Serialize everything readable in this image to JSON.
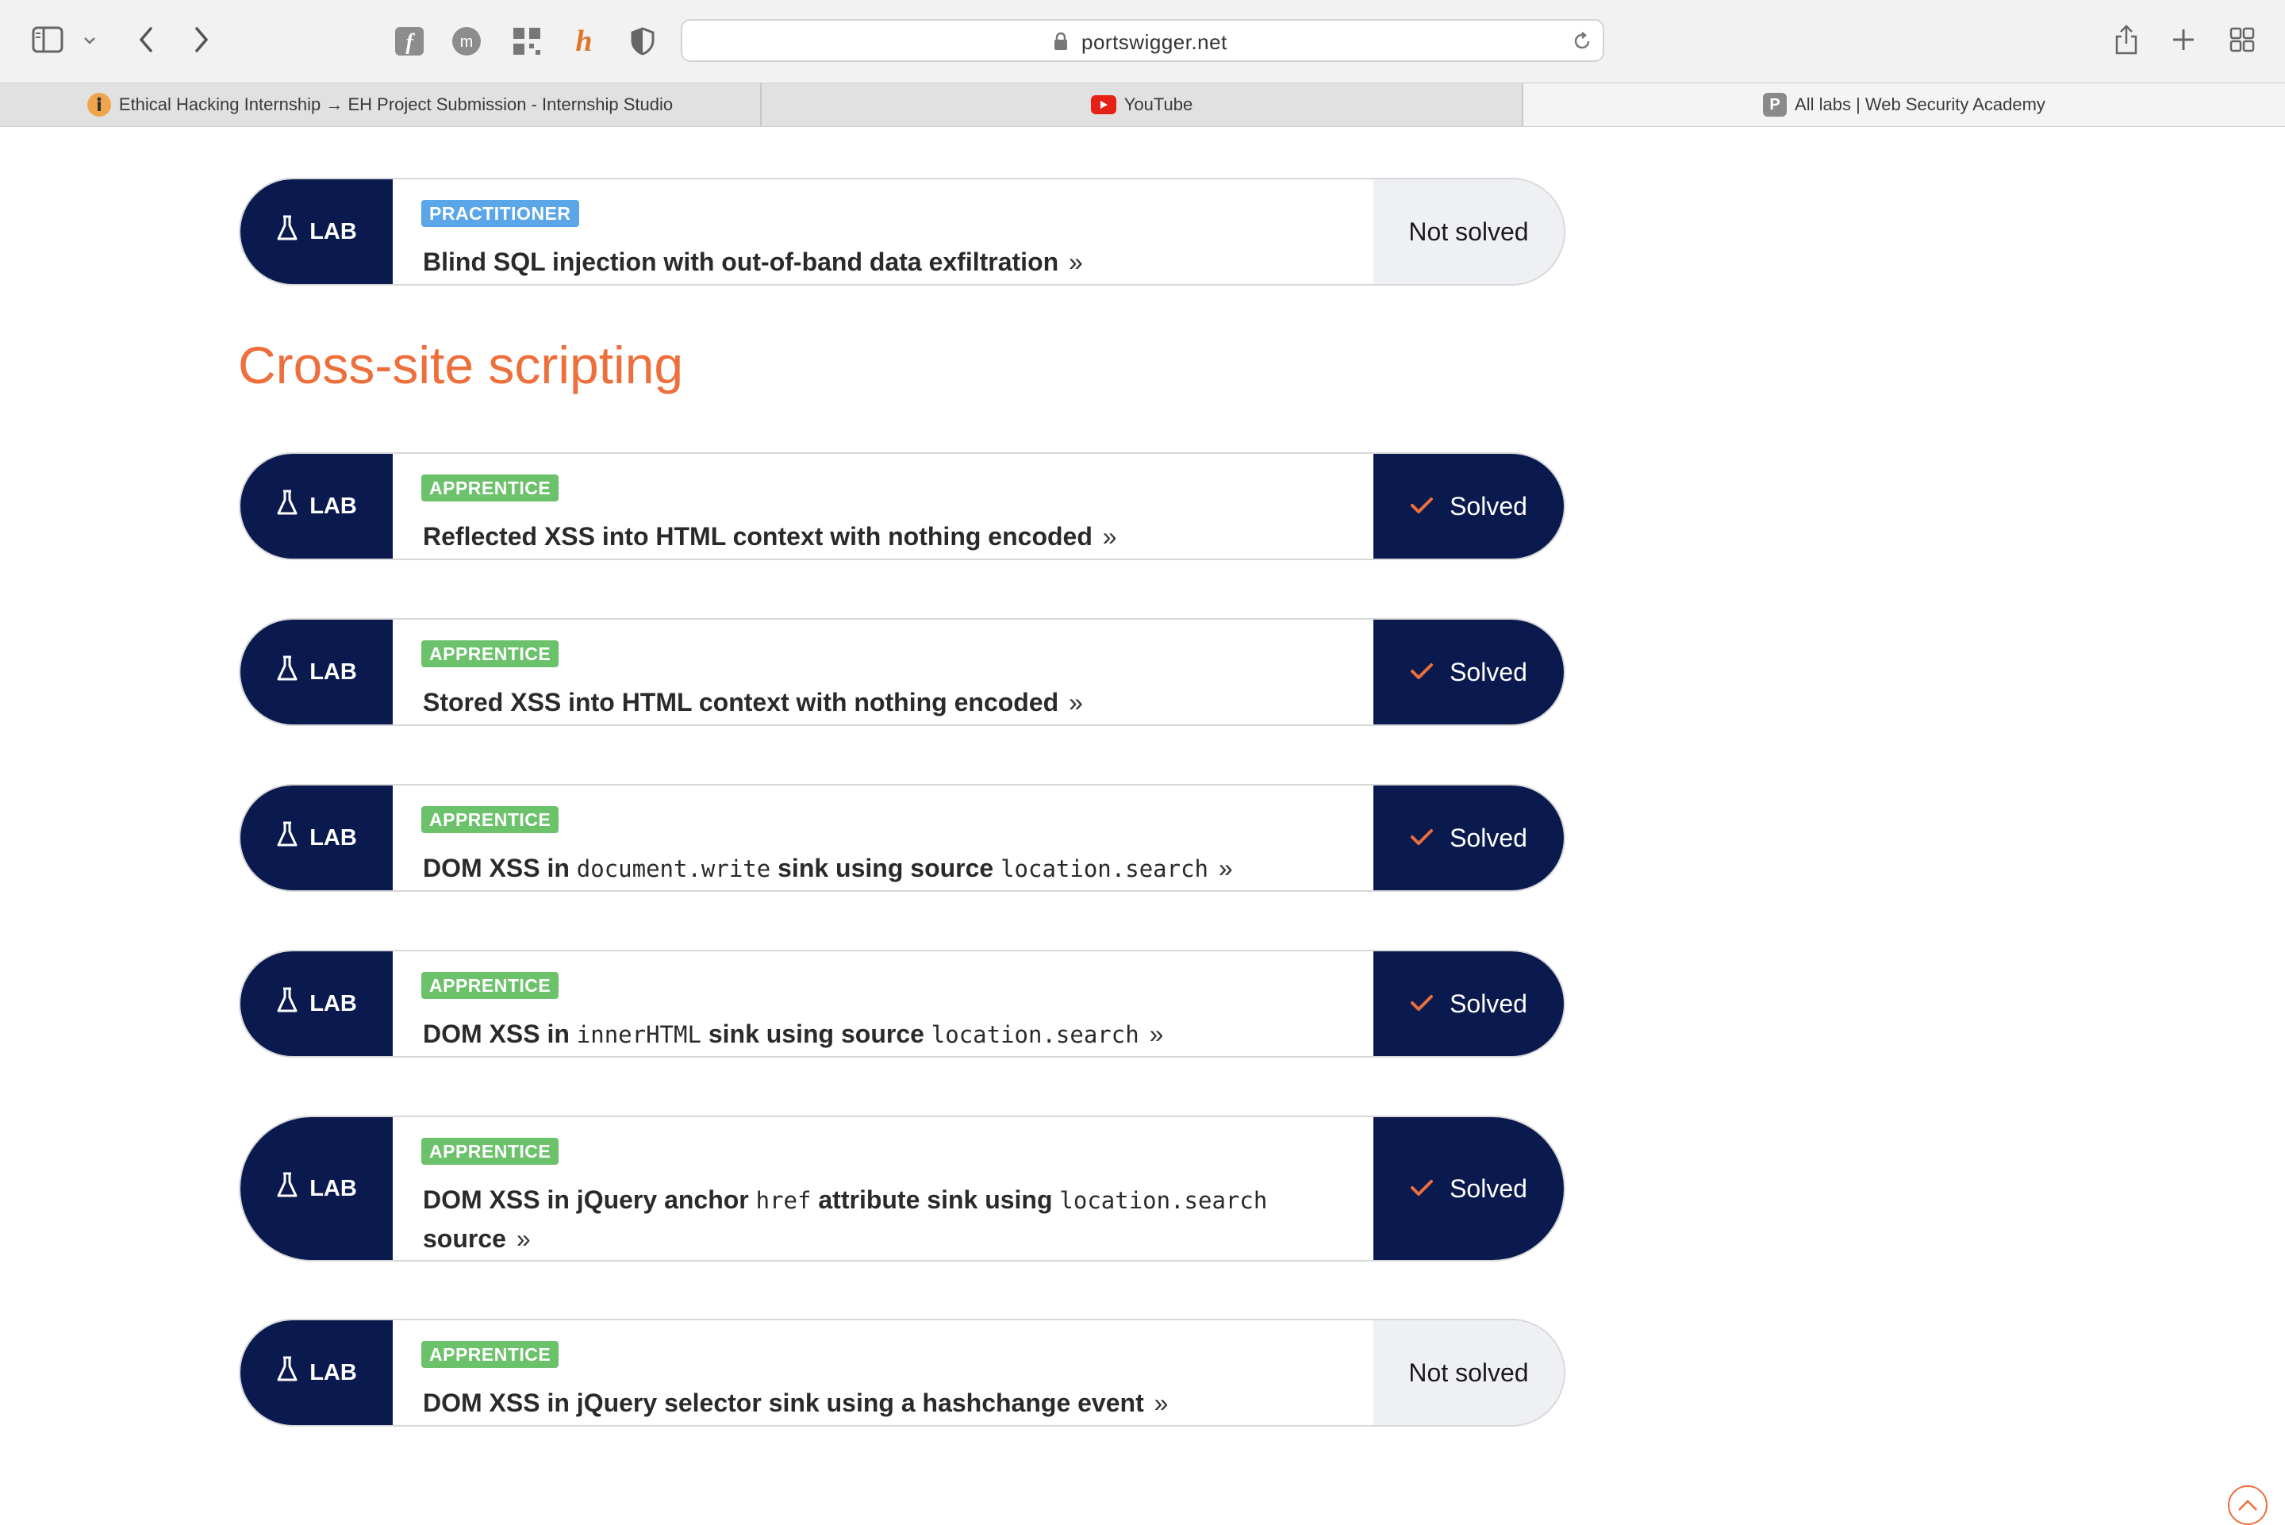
{
  "browser": {
    "url": "portswigger.net",
    "tabs": [
      {
        "title": "Ethical Hacking Internship → EH Project Submission - Internship Studio",
        "favicon": "internship-studio-icon"
      },
      {
        "title": "YouTube",
        "favicon": "youtube-icon"
      },
      {
        "title": "All labs | Web Security Academy",
        "favicon": "portswigger-p-icon",
        "favicon_letter": "P"
      }
    ]
  },
  "labels": {
    "lab": "LAB",
    "solved": "Solved",
    "not_solved": "Not solved",
    "chevron": "»"
  },
  "section_title": "Cross-site scripting",
  "labs": [
    {
      "level": "PRACTITIONER",
      "title": "Blind SQL injection with out-of-band data exfiltration",
      "status": "Not solved"
    },
    {
      "level": "APPRENTICE",
      "title": "Reflected XSS into HTML context with nothing encoded",
      "status": "Solved"
    },
    {
      "level": "APPRENTICE",
      "title": "Stored XSS into HTML context with nothing encoded",
      "status": "Solved"
    },
    {
      "level": "APPRENTICE",
      "title_parts": [
        "DOM XSS in ",
        "document.write",
        " sink using source ",
        "location.search"
      ],
      "status": "Solved"
    },
    {
      "level": "APPRENTICE",
      "title_parts": [
        "DOM XSS in ",
        "innerHTML",
        " sink using source ",
        "location.search"
      ],
      "status": "Solved"
    },
    {
      "level": "APPRENTICE",
      "title_parts": [
        "DOM XSS in jQuery anchor ",
        "href",
        " attribute sink using ",
        "location.search",
        " source"
      ],
      "status": "Solved"
    },
    {
      "level": "APPRENTICE",
      "title": "DOM XSS in jQuery selector sink using a hashchange event",
      "status": "Not solved"
    }
  ],
  "colors": {
    "navy": "#0a1a4f",
    "accent_orange": "#ec6f3c",
    "apprentice_green": "#6cc16b",
    "practitioner_blue": "#5aa6e8"
  }
}
